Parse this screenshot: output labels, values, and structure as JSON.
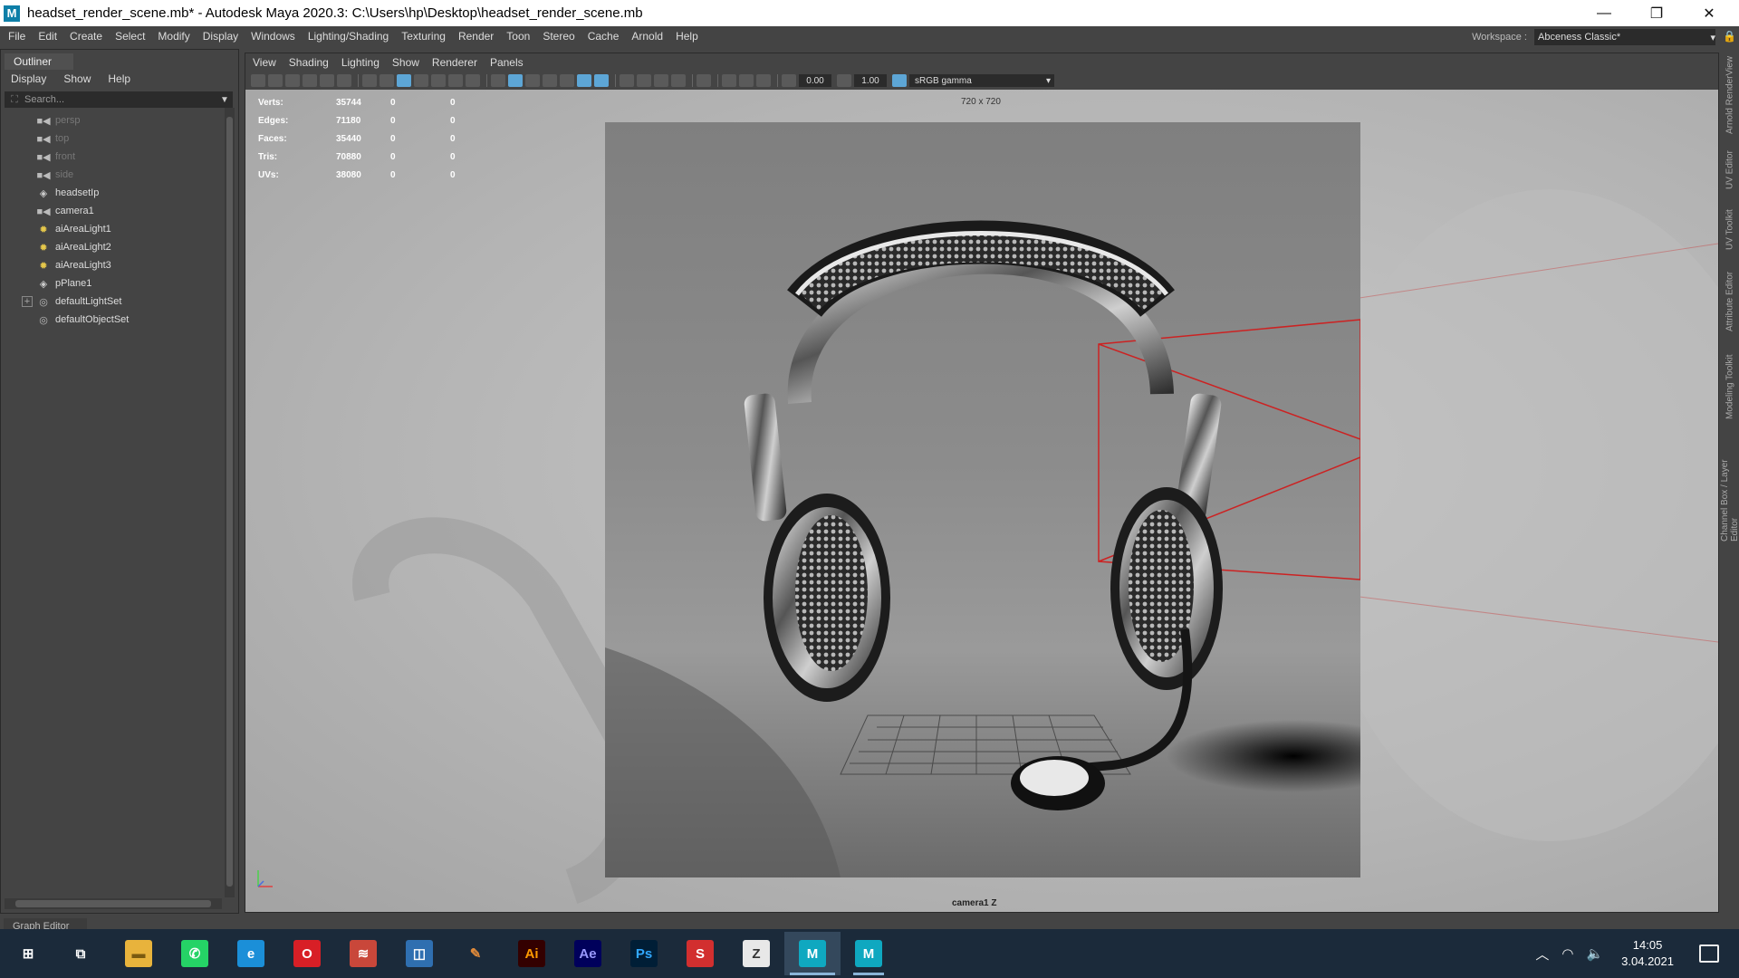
{
  "window": {
    "title": "headset_render_scene.mb* - Autodesk Maya 2020.3: C:\\Users\\hp\\Desktop\\headset_render_scene.mb",
    "app_icon": "M",
    "minimize": "—",
    "restore": "❐",
    "close": "✕"
  },
  "menubar": {
    "items": [
      "File",
      "Edit",
      "Create",
      "Select",
      "Modify",
      "Display",
      "Windows",
      "Lighting/Shading",
      "Texturing",
      "Render",
      "Toon",
      "Stereo",
      "Cache",
      "Arnold",
      "Help"
    ]
  },
  "workspace": {
    "label": "Workspace :",
    "value": "Abceness Classic*"
  },
  "outliner": {
    "tab": "Outliner",
    "menu": [
      "Display",
      "Show",
      "Help"
    ],
    "search_placeholder": "Search...",
    "items": [
      {
        "label": "persp",
        "icon": "camera-icon",
        "dim": true,
        "expandable": false
      },
      {
        "label": "top",
        "icon": "camera-icon",
        "dim": true,
        "expandable": false
      },
      {
        "label": "front",
        "icon": "camera-icon",
        "dim": true,
        "expandable": false
      },
      {
        "label": "side",
        "icon": "camera-icon",
        "dim": true,
        "expandable": false
      },
      {
        "label": "headsetIp",
        "icon": "mesh-icon",
        "dim": false,
        "expandable": false
      },
      {
        "label": "camera1",
        "icon": "camera-icon",
        "dim": false,
        "expandable": false
      },
      {
        "label": "aiAreaLight1",
        "icon": "area-light-icon",
        "dim": false,
        "expandable": false
      },
      {
        "label": "aiAreaLight2",
        "icon": "area-light-icon",
        "dim": false,
        "expandable": false
      },
      {
        "label": "aiAreaLight3",
        "icon": "area-light-icon",
        "dim": false,
        "expandable": false
      },
      {
        "label": "pPlane1",
        "icon": "mesh-icon",
        "dim": false,
        "expandable": false
      },
      {
        "label": "defaultLightSet",
        "icon": "set-icon",
        "dim": false,
        "expandable": true
      },
      {
        "label": "defaultObjectSet",
        "icon": "set-icon",
        "dim": false,
        "expandable": false
      }
    ]
  },
  "graph_editor_tab": "Graph Editor",
  "viewport": {
    "menu": [
      "View",
      "Shading",
      "Lighting",
      "Show",
      "Renderer",
      "Panels"
    ],
    "exposure": "0.00",
    "gamma": "1.00",
    "color_space": "sRGB gamma",
    "hud": [
      {
        "label": "Verts:",
        "v1": "35744",
        "v2": "0",
        "v3": "0"
      },
      {
        "label": "Edges:",
        "v1": "71180",
        "v2": "0",
        "v3": "0"
      },
      {
        "label": "Faces:",
        "v1": "35440",
        "v2": "0",
        "v3": "0"
      },
      {
        "label": "Tris:",
        "v1": "70880",
        "v2": "0",
        "v3": "0"
      },
      {
        "label": "UVs:",
        "v1": "38080",
        "v2": "0",
        "v3": "0"
      }
    ],
    "resolution": "720 x 720",
    "camera": "camera1 Z"
  },
  "side_tabs": [
    "Arnold RenderView",
    "UV Editor",
    "UV Toolkit",
    "Attribute Editor",
    "Modeling Toolkit",
    "Channel Box / Layer Editor"
  ],
  "taskbar": {
    "apps": [
      {
        "name": "start-icon",
        "glyph": "⊞",
        "bg": "transparent",
        "fg": "#ffffff"
      },
      {
        "name": "task-view-icon",
        "glyph": "⧉",
        "bg": "transparent",
        "fg": "#ffffff"
      },
      {
        "name": "file-explorer-icon",
        "glyph": "▬",
        "bg": "#e8b33c",
        "fg": "#7a5a10"
      },
      {
        "name": "whatsapp-icon",
        "glyph": "✆",
        "bg": "#25d366",
        "fg": "#ffffff"
      },
      {
        "name": "edge-icon",
        "glyph": "e",
        "bg": "#1b8fd8",
        "fg": "#ffffff"
      },
      {
        "name": "opera-icon",
        "glyph": "O",
        "bg": "#d81f26",
        "fg": "#ffffff"
      },
      {
        "name": "winrar-icon",
        "glyph": "≋",
        "bg": "#c9473a",
        "fg": "#ffffff"
      },
      {
        "name": "substance-designer-icon",
        "glyph": "◫",
        "bg": "#2f6fb0",
        "fg": "#ffffff"
      },
      {
        "name": "pencil-icon",
        "glyph": "✎",
        "bg": "transparent",
        "fg": "#e08a3a"
      },
      {
        "name": "illustrator-icon",
        "glyph": "Ai",
        "bg": "#330000",
        "fg": "#ff9a00"
      },
      {
        "name": "after-effects-icon",
        "glyph": "Ae",
        "bg": "#00005b",
        "fg": "#9999ff"
      },
      {
        "name": "photoshop-icon",
        "glyph": "Ps",
        "bg": "#001e36",
        "fg": "#31a8ff"
      },
      {
        "name": "substance-painter-icon",
        "glyph": "S",
        "bg": "#d22f2f",
        "fg": "#ffffff"
      },
      {
        "name": "zbrush-icon",
        "glyph": "Z",
        "bg": "#e8e8e8",
        "fg": "#333333"
      },
      {
        "name": "maya-icon",
        "glyph": "M",
        "bg": "#0fa8c0",
        "fg": "#ffffff"
      },
      {
        "name": "maya-icon-2",
        "glyph": "M",
        "bg": "#0fa8c0",
        "fg": "#ffffff"
      }
    ],
    "time": "14:05",
    "date": "3.04.2021"
  },
  "colors": {
    "maya_bg": "#444444",
    "accent": "#5da6d6",
    "light_icon": "#e6c84b",
    "taskbar": "#1b2a3a",
    "camera_frustum": "#cc2222"
  }
}
